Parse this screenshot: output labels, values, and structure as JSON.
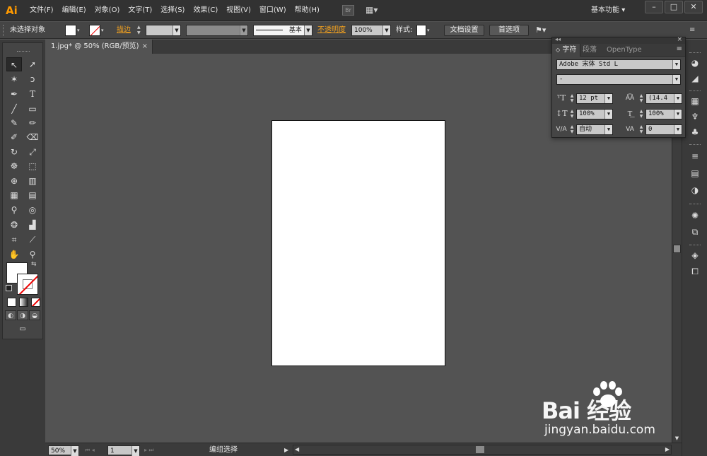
{
  "app": {
    "logo": "Ai"
  },
  "menu": [
    "文件(F)",
    "编辑(E)",
    "对象(O)",
    "文字(T)",
    "选择(S)",
    "效果(C)",
    "视图(V)",
    "窗口(W)",
    "帮助(H)"
  ],
  "menubar": {
    "br_label": "Br",
    "workspace": "基本功能",
    "workspace_arrow": "▾",
    "win_min": "–",
    "win_max": "□",
    "win_close": "✕"
  },
  "controlbar": {
    "selection": "未选择对象",
    "stroke_label": "描边",
    "stroke_style": "基本",
    "opacity_label": "不透明度",
    "opacity_value": "100%",
    "style_label": "样式",
    "doc_setup": "文档设置",
    "preferences": "首选项"
  },
  "document": {
    "tab_title": "1.jpg* @ 50% (RGB/预览)",
    "close": "×"
  },
  "statusbar": {
    "zoom": "50%",
    "page": "1",
    "status": "编组选择"
  },
  "character_panel": {
    "tabs": [
      "字符",
      "段落",
      "OpenType"
    ],
    "font_family": "Adobe 宋体 Std L",
    "font_style": "-",
    "font_size": "12 pt",
    "leading": "(14.4",
    "vertical_scale": "100%",
    "horizontal_scale": "100%",
    "kerning": "自动",
    "tracking": "0"
  },
  "watermark": {
    "main": "Bai 经验",
    "sub": "jingyan.baidu.com"
  },
  "colors": {
    "accent_orange": "#f0a020",
    "logo_orange": "#ff9a00",
    "canvas_bg": "#535353",
    "panel_bg": "#454545"
  }
}
